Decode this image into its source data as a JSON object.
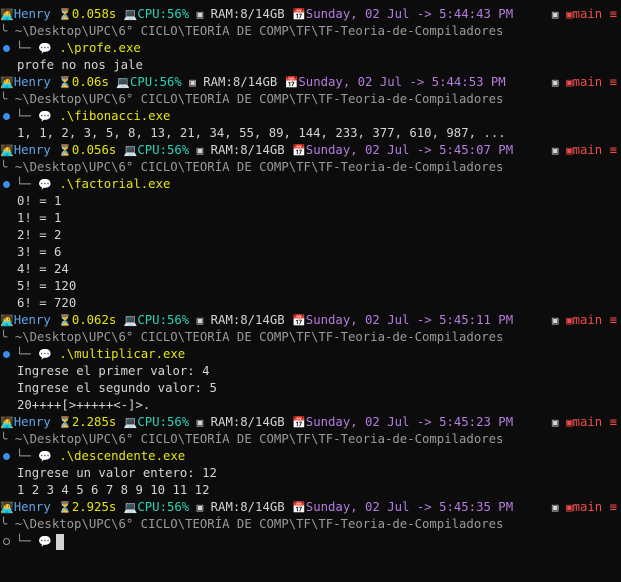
{
  "colors": {
    "background": "#0c0c0c",
    "user": "#61a6e8",
    "elapsed": "#e5e510",
    "cpu": "#2bd2b3",
    "date": "#b67ce0",
    "git_branch": "#f14c4c",
    "path": "#9a9a9a",
    "command": "#e5e510",
    "prompt_dot": "#3b8eea"
  },
  "status": {
    "user": "Henry",
    "cpu_label": "CPU:56%",
    "ram_label": "RAM:8/14GB",
    "date_prefix": "Sunday, 02 Jul -> ",
    "branch": "main",
    "branch_suffix": "≡",
    "path": "~\\Desktop\\UPC\\6° CICLO\\TEORÍA DE COMP\\TF\\TF-Teoria-de-Compiladores",
    "tree_top": "╰",
    "tree_bottom": "└─",
    "prompt_glyph": "💬"
  },
  "blocks": [
    {
      "elapsed": "0.058s",
      "clock": "5:44:43 PM",
      "command": ".\\profe.exe",
      "output": [
        "profe no nos jale"
      ]
    },
    {
      "elapsed": "0.06s",
      "clock": "5:44:53 PM",
      "command": ".\\fibonacci.exe",
      "output": [
        "1, 1, 2, 3, 5, 8, 13, 21, 34, 55, 89, 144, 233, 377, 610, 987, ..."
      ]
    },
    {
      "elapsed": "0.056s",
      "clock": "5:45:07 PM",
      "command": ".\\factorial.exe",
      "output": [
        "0! = 1",
        "1! = 1",
        "2! = 2",
        "3! = 6",
        "4! = 24",
        "5! = 120",
        "6! = 720"
      ]
    },
    {
      "elapsed": "0.062s",
      "clock": "5:45:11 PM",
      "command": ".\\multiplicar.exe",
      "output": [
        "Ingrese el primer valor: 4",
        "Ingrese el segundo valor: 5",
        "20++++[>+++++<-]>."
      ]
    },
    {
      "elapsed": "2.285s",
      "clock": "5:45:23 PM",
      "command": ".\\descendente.exe",
      "output": [
        "Ingrese un valor entero: 12",
        "1 2 3 4 5 6 7 8 9 10 11 12"
      ]
    },
    {
      "elapsed": "2.925s",
      "clock": "5:45:35 PM",
      "command": "",
      "output": []
    }
  ],
  "icons": {
    "user": "person-laptop-icon",
    "hourglass": "hourglass-icon",
    "cpu": "laptop-icon",
    "ram": "memory-icon",
    "calendar": "calendar-icon",
    "git": "git-branch-icon",
    "prompt": "speech-bubble-icon"
  }
}
